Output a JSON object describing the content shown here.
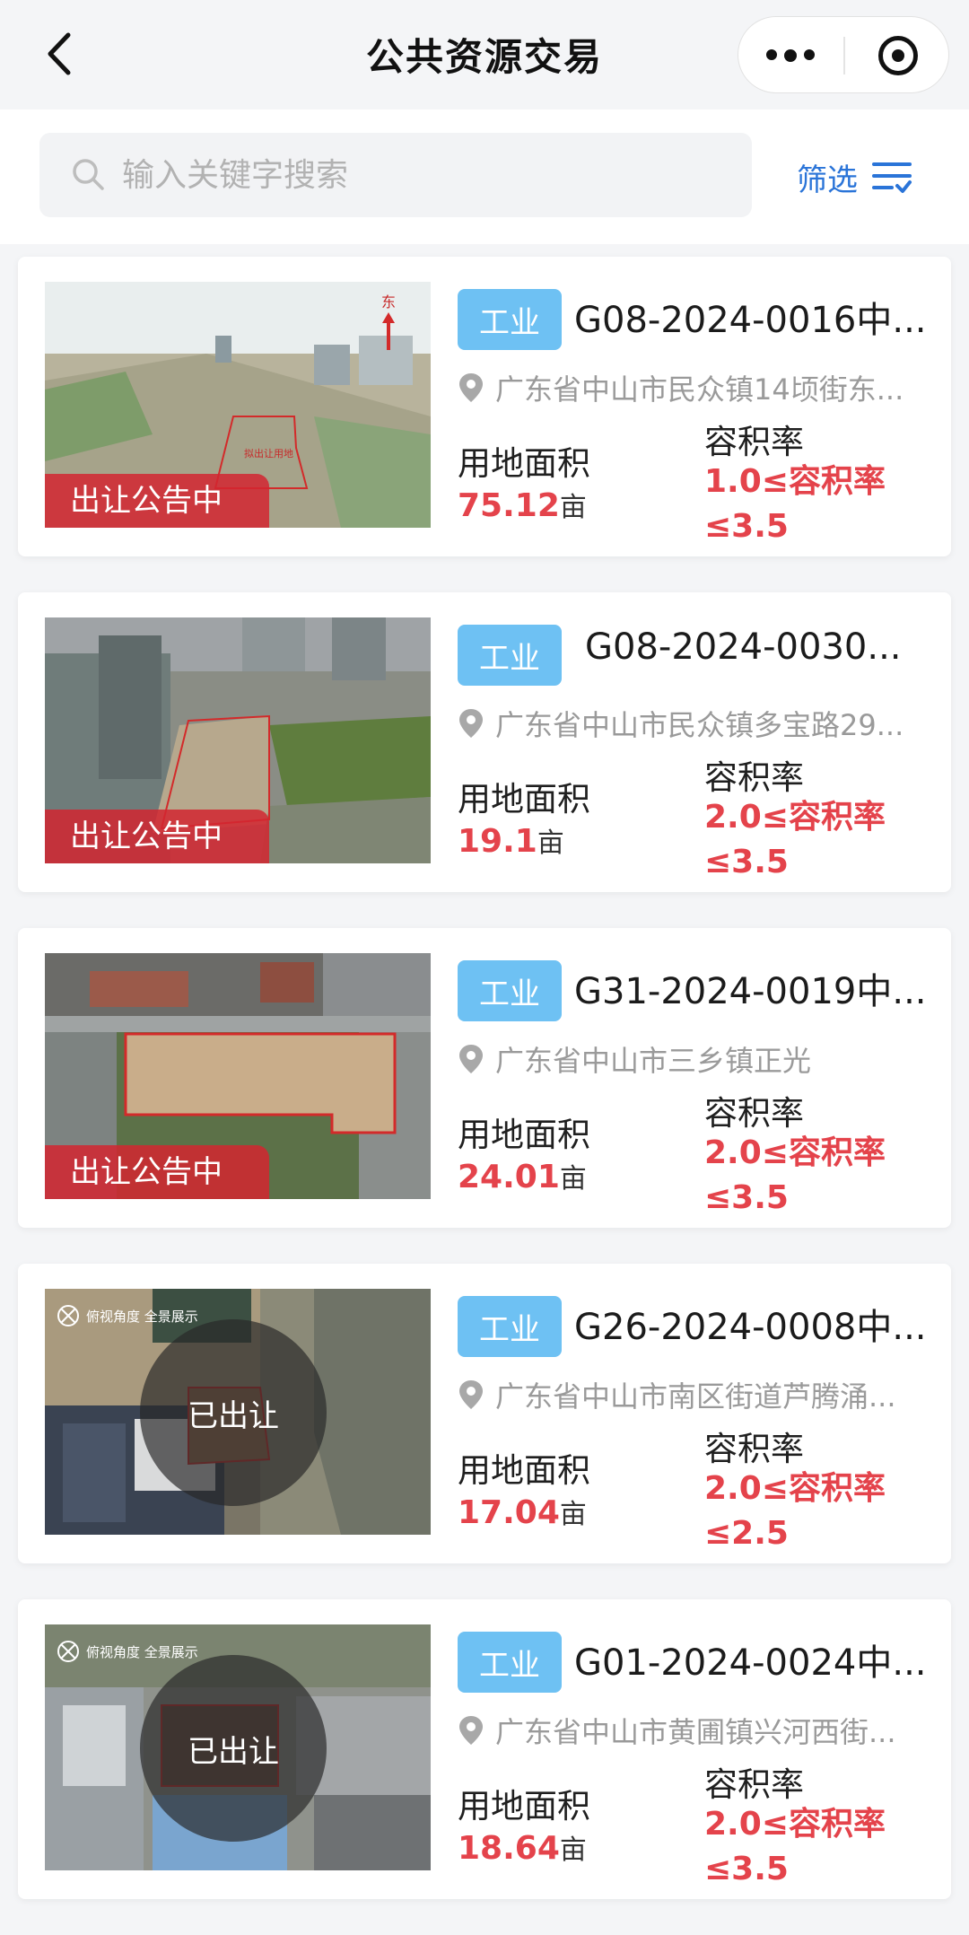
{
  "header": {
    "title": "公共资源交易"
  },
  "search": {
    "placeholder": "输入关键字搜索",
    "filter_label": "筛选"
  },
  "labels": {
    "area": "用地面积",
    "far": "容积率",
    "unit": "亩"
  },
  "listings": [
    {
      "status": "出让公告中",
      "status_style": "strip",
      "category": "工业",
      "title": "G08-2024-0016中...",
      "location": "广东省中山市民众镇14顷街东...",
      "area": "75.12",
      "far_line1": "1.0≤容积率",
      "far_line2": "≤3.5",
      "thumb_texts": [
        "东",
        "拟出让用地"
      ]
    },
    {
      "status": "出让公告中",
      "status_style": "strip",
      "category": "工业",
      "title": "G08-2024-0030...",
      "location": "广东省中山市民众镇多宝路29...",
      "area": "19.1",
      "far_line1": "2.0≤容积率",
      "far_line2": "≤3.5",
      "thumb_texts": []
    },
    {
      "status": "出让公告中",
      "status_style": "strip",
      "category": "工业",
      "title": "G31-2024-0019中...",
      "location": "广东省中山市三乡镇正光",
      "area": "24.01",
      "far_line1": "2.0≤容积率",
      "far_line2": "≤3.5",
      "thumb_texts": []
    },
    {
      "status": "已出让",
      "status_style": "circle",
      "category": "工业",
      "title": "G26-2024-0008中...",
      "location": "广东省中山市南区街道芦腾涌...",
      "area": "17.04",
      "far_line1": "2.0≤容积率",
      "far_line2": "≤2.5",
      "thumb_texts": [
        "俯视角度 全景展示"
      ]
    },
    {
      "status": "已出让",
      "status_style": "circle",
      "category": "工业",
      "title": "G01-2024-0024中...",
      "location": "广东省中山市黄圃镇兴河西街...",
      "area": "18.64",
      "far_line1": "2.0≤容积率",
      "far_line2": "≤3.5",
      "thumb_texts": [
        "俯视角度 全景展示"
      ]
    }
  ],
  "colors": {
    "accent": "#2a74d8",
    "tag": "#6ec1f3",
    "price_red": "#e4434b",
    "status_red": "#d22630"
  }
}
